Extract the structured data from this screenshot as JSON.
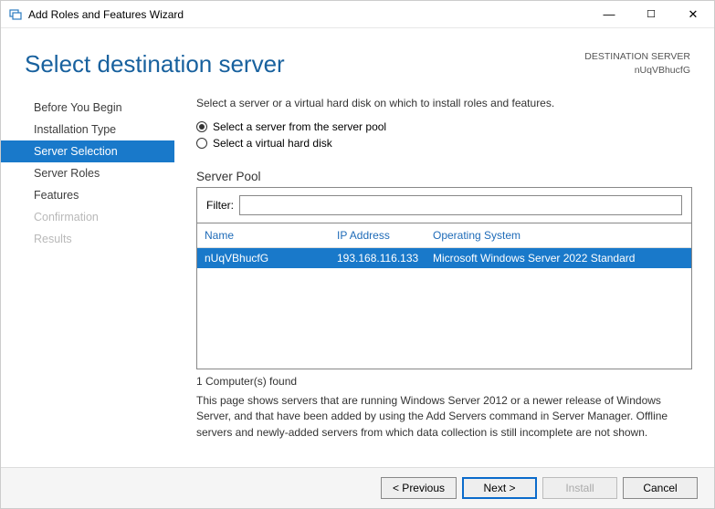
{
  "window": {
    "title": "Add Roles and Features Wizard"
  },
  "header": {
    "title": "Select destination server",
    "dest_label": "DESTINATION SERVER",
    "dest_value": "nUqVBhucfG"
  },
  "sidebar": {
    "items": [
      {
        "label": "Before You Begin",
        "state": "normal"
      },
      {
        "label": "Installation Type",
        "state": "normal"
      },
      {
        "label": "Server Selection",
        "state": "active"
      },
      {
        "label": "Server Roles",
        "state": "normal"
      },
      {
        "label": "Features",
        "state": "normal"
      },
      {
        "label": "Confirmation",
        "state": "disabled"
      },
      {
        "label": "Results",
        "state": "disabled"
      }
    ]
  },
  "main": {
    "instruction": "Select a server or a virtual hard disk on which to install roles and features.",
    "radio1": "Select a server from the server pool",
    "radio2": "Select a virtual hard disk",
    "pool_label": "Server Pool",
    "filter_label": "Filter:",
    "filter_value": "",
    "columns": {
      "name": "Name",
      "ip": "IP Address",
      "os": "Operating System"
    },
    "rows": [
      {
        "name": "nUqVBhucfG",
        "ip": "193.168.116.133",
        "os": "Microsoft Windows Server 2022 Standard"
      }
    ],
    "count_text": "1 Computer(s) found",
    "info_text": "This page shows servers that are running Windows Server 2012 or a newer release of Windows Server, and that have been added by using the Add Servers command in Server Manager. Offline servers and newly-added servers from which data collection is still incomplete are not shown."
  },
  "footer": {
    "previous": "< Previous",
    "next": "Next >",
    "install": "Install",
    "cancel": "Cancel"
  }
}
